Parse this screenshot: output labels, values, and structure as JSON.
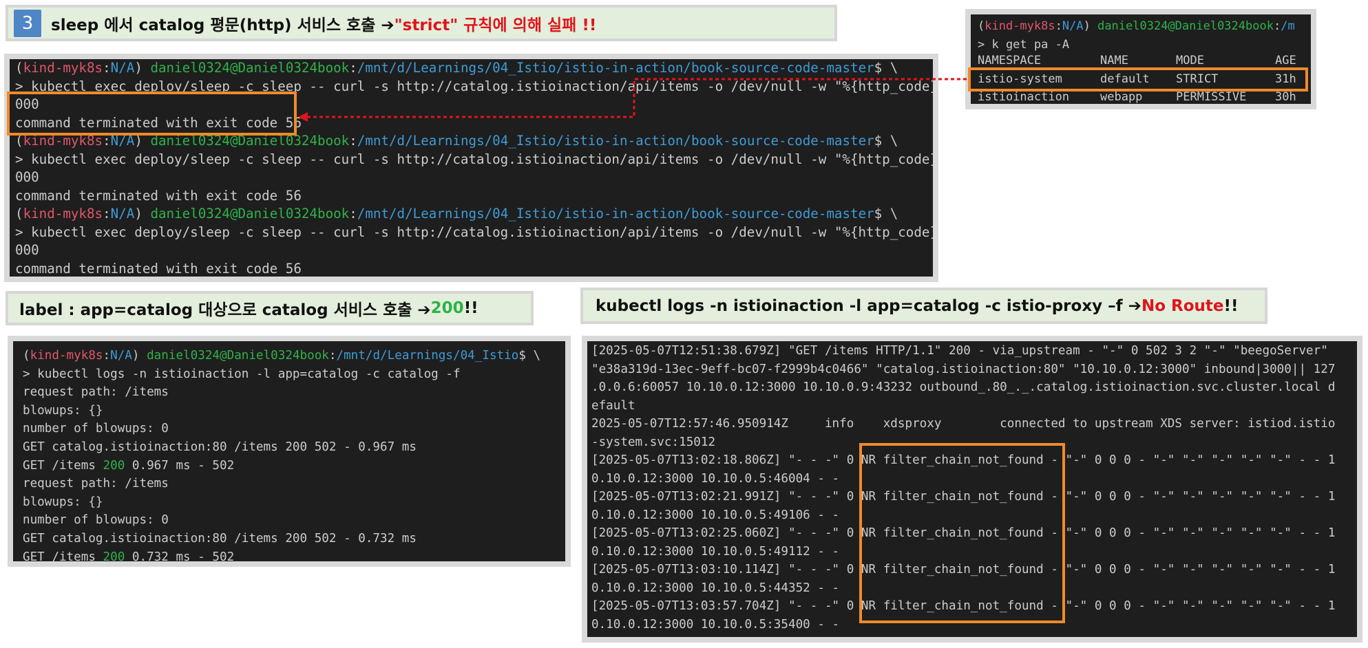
{
  "banner_step": {
    "number": "3",
    "before": "sleep 에서 catalog 평문(http) 서비스 호출 ➔ ",
    "highlight": "\"strict\" 규칙에 의해 실패 !!"
  },
  "banner_label": {
    "before": "label : app=catalog  대상으로 catalog 서비스 호출 ➔ ",
    "code": "200",
    "after": "!!"
  },
  "banner_logs": {
    "before": "kubectl logs -n istioinaction -l app=catalog -c istio-proxy –f ➔ ",
    "highlight": "No Route",
    "after": "!!"
  },
  "prompt": {
    "open": "(",
    "context": "kind-myk8s",
    "sep": ":",
    "ns": "N/A",
    "close": ")",
    "user": "daniel0324@Daniel0324book",
    "colon": ":",
    "path_full": "/mnt/d/Learnings/04_Istio/istio-in-action/book-source-code-master",
    "path_short": "/mnt/d/Learnings/04_Istio",
    "suffix": "$ \\",
    "path_cut": "/m"
  },
  "terminal_main": {
    "curl_cmd": "> kubectl exec deploy/sleep -c sleep -- curl -s http://catalog.istioinaction/api/items -o /dev/null -w \"%{http_code}\\n\"",
    "status_out": "000",
    "error_msg": "command terminated with exit code 56"
  },
  "terminal_pa": {
    "command": "> k get pa -A",
    "headers": [
      "NAMESPACE",
      "NAME",
      "MODE",
      "AGE"
    ],
    "rows": [
      [
        "istio-system",
        "default",
        "STRICT",
        "31h"
      ],
      [
        "istioinaction",
        "webapp",
        "PERMISSIVE",
        "30h"
      ]
    ]
  },
  "terminal_catalog": {
    "command": "> kubectl logs -n istioinaction -l app=catalog -c catalog -f",
    "lines": [
      "request path: /items",
      "blowups: {}",
      "number of blowups: 0",
      "GET catalog.istioinaction:80 /items 200 502 - 0.967 ms"
    ],
    "get1_pre": "GET /items ",
    "get1_code": "200",
    "get1_post": " 0.967 ms - 502",
    "lines2": [
      "request path: /items",
      "blowups: {}",
      "number of blowups: 0",
      "GET catalog.istioinaction:80 /items 200 502 - 0.732 ms"
    ],
    "get2_pre": "GET /items ",
    "get2_code": "200",
    "get2_post": " 0.732 ms - 502"
  },
  "terminal_proxy": {
    "lines": [
      "[2025-05-07T12:51:38.679Z] \"GET /items HTTP/1.1\" 200 - via_upstream - \"-\" 0 502 3 2 \"-\" \"beegoServer\"",
      "\"e38a319d-13ec-9eff-bc07-f2999b4c0466\" \"catalog.istioinaction:80\" \"10.10.0.12:3000\" inbound|3000|| 127",
      ".0.0.6:60057 10.10.0.12:3000 10.10.0.9:43232 outbound_.80_._.catalog.istioinaction.svc.cluster.local d",
      "efault",
      "2025-05-07T12:57:46.950914Z     info    xdsproxy        connected to upstream XDS server: istiod.istio",
      "-system.svc:15012",
      "[2025-05-07T13:02:18.806Z] \"- - -\" 0 NR filter_chain_not_found - \"-\" 0 0 0 - \"-\" \"-\" \"-\" \"-\" \"-\" - - 1",
      "0.10.0.12:3000 10.10.0.5:46004 - -",
      "[2025-05-07T13:02:21.991Z] \"- - -\" 0 NR filter_chain_not_found - \"-\" 0 0 0 - \"-\" \"-\" \"-\" \"-\" \"-\" - - 1",
      "0.10.0.12:3000 10.10.0.5:49106 - -",
      "[2025-05-07T13:02:25.060Z] \"- - -\" 0 NR filter_chain_not_found - \"-\" 0 0 0 - \"-\" \"-\" \"-\" \"-\" \"-\" - - 1",
      "0.10.0.12:3000 10.10.0.5:49112 - -",
      "[2025-05-07T13:03:10.114Z] \"- - -\" 0 NR filter_chain_not_found - \"-\" 0 0 0 - \"-\" \"-\" \"-\" \"-\" \"-\" - - 1",
      "0.10.0.12:3000 10.10.0.5:44352 - -",
      "[2025-05-07T13:03:57.704Z] \"- - -\" 0 NR filter_chain_not_found - \"-\" 0 0 0 - \"-\" \"-\" \"-\" \"-\" \"-\" - - 1",
      "0.10.0.12:3000 10.10.0.5:35400 - -"
    ]
  },
  "colors": {
    "highlight_box": "#f08a2b",
    "arrow": "#e2131b",
    "terminal_bg": "#1e1e1e",
    "banner_bg": "#e3efdc"
  }
}
